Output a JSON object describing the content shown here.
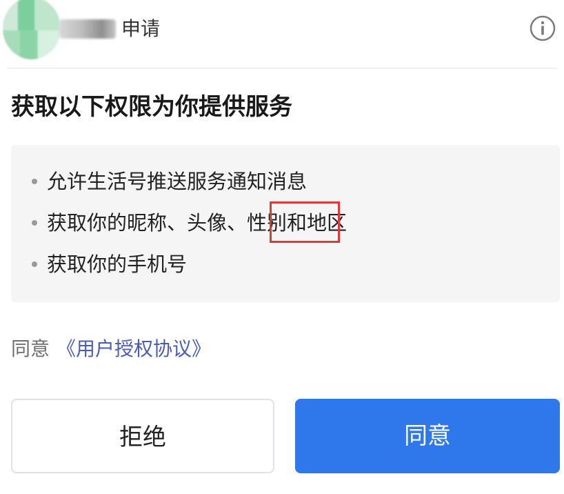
{
  "header": {
    "title": "申请"
  },
  "heading": "获取以下权限为你提供服务",
  "permissions": [
    "允许生活号推送服务通知消息",
    "获取你的昵称、头像、性别和地区",
    "获取你的手机号"
  ],
  "agreement": {
    "prefix": "同意",
    "link": "《用户授权协议》"
  },
  "buttons": {
    "reject": "拒绝",
    "agree": "同意"
  },
  "colors": {
    "primary": "#2f78ec",
    "link": "#4b5bb8",
    "highlight_border": "#d93b3b"
  },
  "icons": {
    "info": "info-circle-icon"
  }
}
